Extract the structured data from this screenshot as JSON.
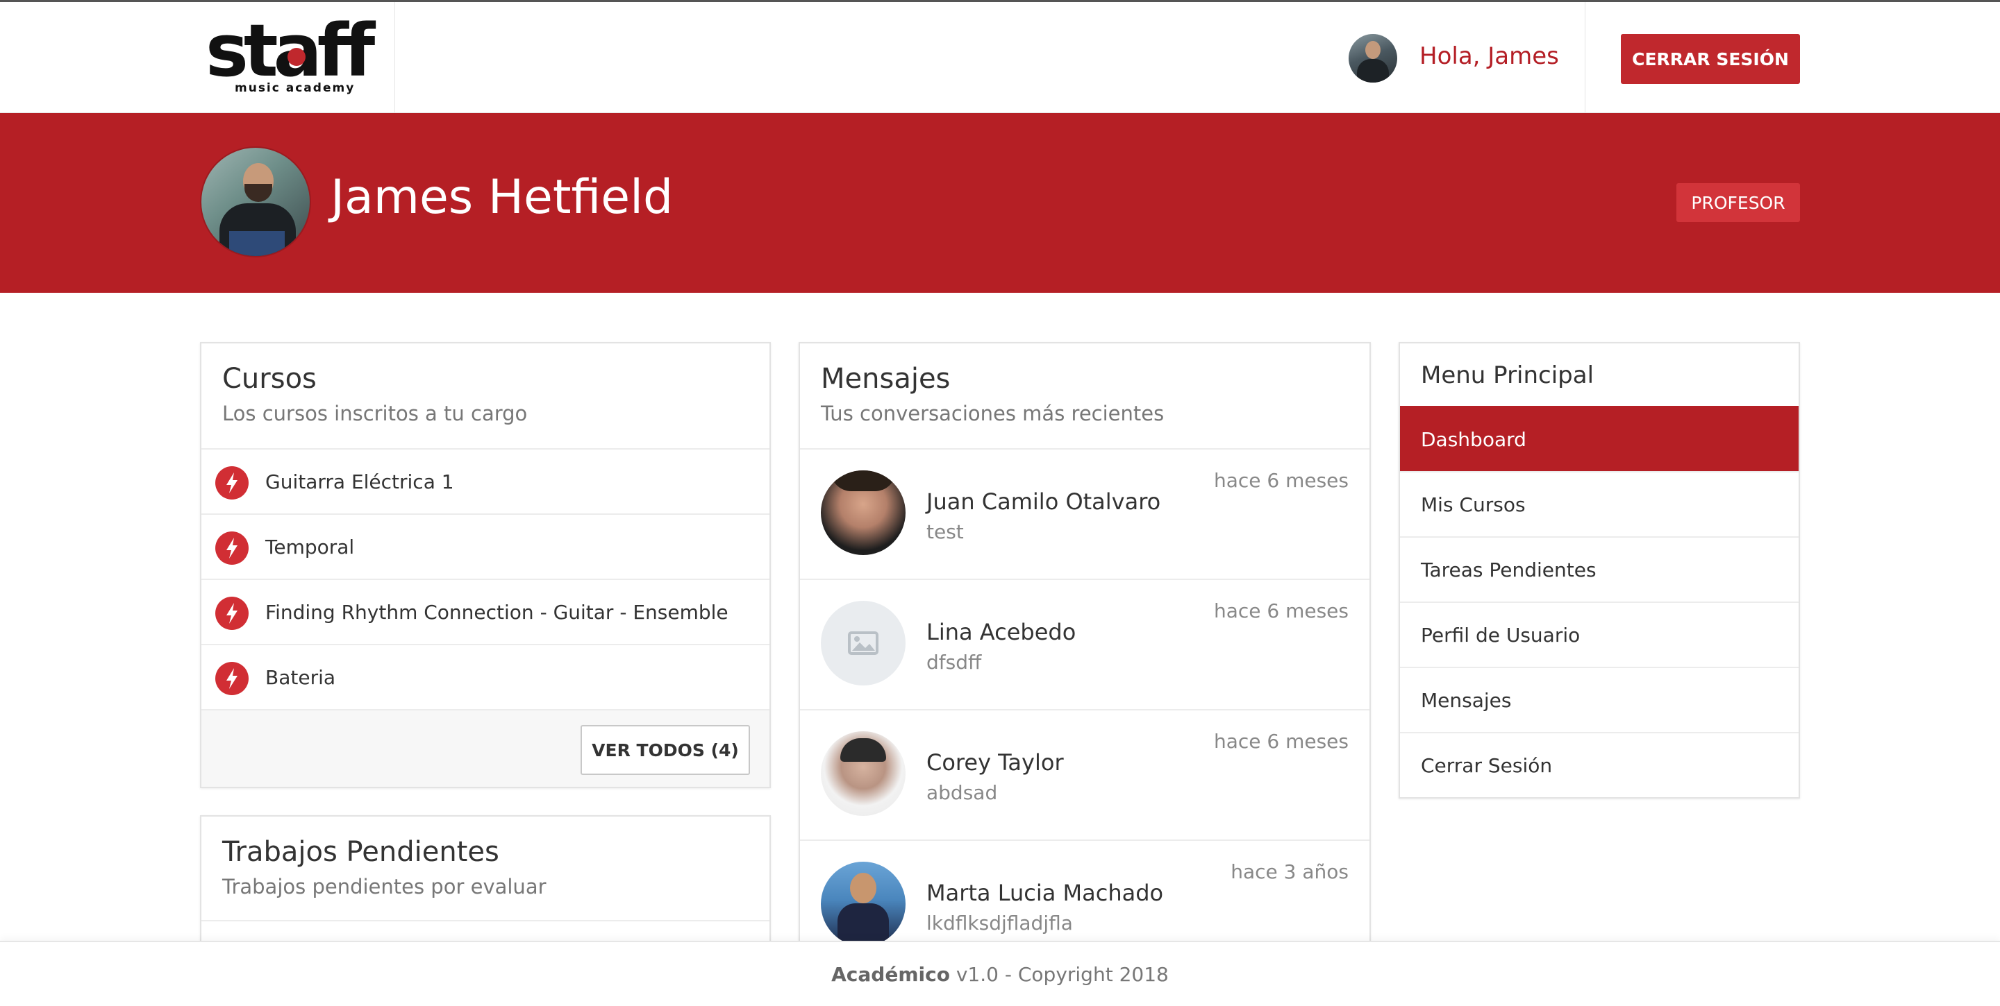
{
  "navbar": {
    "logo_text": "staff",
    "logo_subtext": "music academy",
    "greeting": "Hola, James",
    "logout_label": "CERRAR SESIÓN"
  },
  "profile": {
    "name": "James Hetfield",
    "role_badge": "PROFESOR",
    "accent_color": "#b51f25"
  },
  "cursos": {
    "title": "Cursos",
    "subtitle": "Los cursos inscritos a tu cargo",
    "icon": "bolt-icon",
    "items": [
      {
        "label": "Guitarra Eléctrica 1"
      },
      {
        "label": "Temporal"
      },
      {
        "label": "Finding Rhythm Connection - Guitar - Ensemble"
      },
      {
        "label": "Bateria"
      }
    ],
    "view_all_label": "VER TODOS (4)"
  },
  "trabajos": {
    "title": "Trabajos Pendientes",
    "subtitle": "Trabajos pendientes por evaluar"
  },
  "mensajes": {
    "title": "Mensajes",
    "subtitle": "Tus conversaciones más recientes",
    "items": [
      {
        "name": "Juan Camilo Otalvaro",
        "text": "test",
        "time": "hace 6 meses"
      },
      {
        "name": "Lina Acebedo",
        "text": "dfsdff",
        "time": "hace 6 meses"
      },
      {
        "name": "Corey Taylor",
        "text": "abdsad",
        "time": "hace 6 meses"
      },
      {
        "name": "Marta Lucia Machado",
        "text": "lkdflksdjfladjfla",
        "time": "hace 3 años"
      }
    ]
  },
  "menu": {
    "title": "Menu Principal",
    "items": [
      {
        "label": "Dashboard",
        "active": true
      },
      {
        "label": "Mis Cursos"
      },
      {
        "label": "Tareas Pendientes"
      },
      {
        "label": "Perfil de Usuario"
      },
      {
        "label": "Mensajes"
      },
      {
        "label": "Cerrar Sesión"
      }
    ]
  },
  "footer": {
    "brand": "Académico",
    "text": " v1.0 - Copyright 2018"
  }
}
